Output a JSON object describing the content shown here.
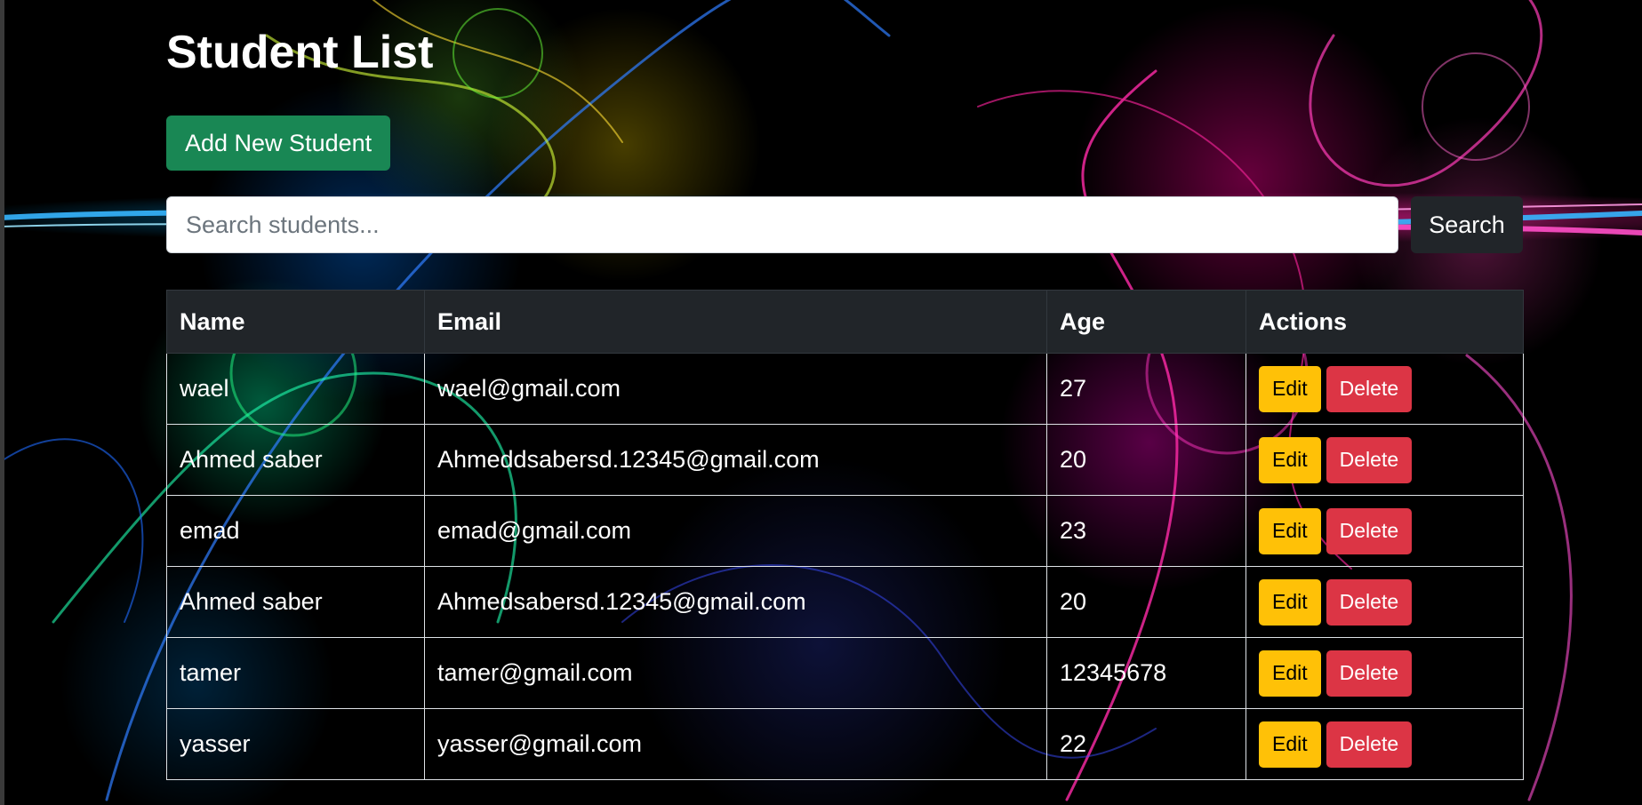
{
  "page": {
    "title": "Student List"
  },
  "toolbar": {
    "add_label": "Add New Student"
  },
  "search": {
    "placeholder": "Search students...",
    "value": "",
    "button_label": "Search"
  },
  "table": {
    "headers": [
      "Name",
      "Email",
      "Age",
      "Actions"
    ],
    "rows": [
      {
        "name": "wael",
        "email": "wael@gmail.com",
        "age": "27",
        "edit": "Edit",
        "delete": "Delete"
      },
      {
        "name": "Ahmed saber",
        "email": "Ahmeddsabersd.12345@gmail.com",
        "age": "20",
        "edit": "Edit",
        "delete": "Delete"
      },
      {
        "name": "emad",
        "email": "emad@gmail.com",
        "age": "23",
        "edit": "Edit",
        "delete": "Delete"
      },
      {
        "name": "Ahmed saber",
        "email": "Ahmedsabersd.12345@gmail.com",
        "age": "20",
        "edit": "Edit",
        "delete": "Delete"
      },
      {
        "name": "tamer",
        "email": "tamer@gmail.com",
        "age": "12345678",
        "edit": "Edit",
        "delete": "Delete"
      },
      {
        "name": "yasser",
        "email": "yasser@gmail.com",
        "age": "22",
        "edit": "Edit",
        "delete": "Delete"
      }
    ]
  },
  "colors": {
    "success": "#198754",
    "dark": "#212529",
    "warning": "#ffc107",
    "danger": "#dc3545"
  }
}
